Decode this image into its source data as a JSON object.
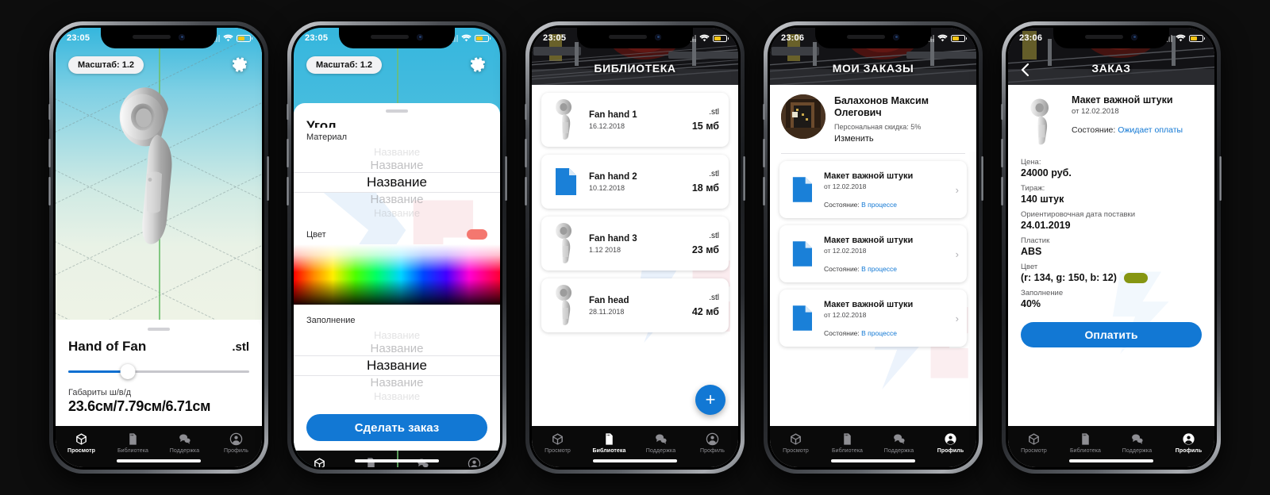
{
  "tabs": [
    {
      "label": "Просмотр",
      "icon": "cube-icon"
    },
    {
      "label": "Библиотека",
      "icon": "sdcard-icon"
    },
    {
      "label": "Поддержка",
      "icon": "chat-icon"
    },
    {
      "label": "Профиль",
      "icon": "person-icon"
    }
  ],
  "colors": {
    "accent": "#1278d4",
    "slider_fill": "#0b6fd1",
    "tab_active": "#ffffff",
    "tab_inactive": "#8e8e93",
    "material_swatch": "#f4776f",
    "order_color_chip": "#869612",
    "dark_header": "#17171a"
  },
  "phone1": {
    "status": {
      "time": "23:05",
      "battery": "60"
    },
    "scale_chip": "Масштаб: 1.2",
    "gear": "gear-icon",
    "sheet": {
      "title": "Hand of Fan",
      "extension": ".stl",
      "slider_value": "33",
      "dim_label": "Габариты ш/в/д",
      "dim_value": "23.6см/7.79см/6.71см"
    },
    "active_tab": 0
  },
  "phone2": {
    "status": {
      "time": "23:05",
      "battery": "60"
    },
    "scale_chip": "Масштаб: 1.2",
    "clipped_title": "Угол",
    "material": {
      "label": "Материал",
      "options": [
        "Название",
        "Название",
        "Название",
        "Название",
        "Название"
      ],
      "selected_index": 2
    },
    "color": {
      "label": "Цвет",
      "swatch": "#f4776f"
    },
    "infill": {
      "label": "Заполнение",
      "options": [
        "Название",
        "Название",
        "Название",
        "Название",
        "Название"
      ],
      "selected_index": 2
    },
    "order_button": "Сделать заказ",
    "active_tab": 0
  },
  "phone3": {
    "status": {
      "time": "23:05",
      "battery": "60"
    },
    "header_title": "БИБЛИОТЕКА",
    "files": [
      {
        "name": "Fan hand 1",
        "date": "16.12.2018",
        "ext": ".stl",
        "size": "15 мб",
        "thumb": "model-thumb"
      },
      {
        "name": "Fan hand 2",
        "date": "10.12.2018",
        "ext": ".stl",
        "size": "18 мб",
        "thumb": "file-icon"
      },
      {
        "name": "Fan hand 3",
        "date": "1.12 2018",
        "ext": ".stl",
        "size": "23 мб",
        "thumb": "model-thumb"
      },
      {
        "name": "Fan head",
        "date": "28.11.2018",
        "ext": ".stl",
        "size": "42 мб",
        "thumb": "model-thumb"
      }
    ],
    "fab_label": "+",
    "active_tab": 1
  },
  "phone4": {
    "status": {
      "time": "23:06",
      "battery": "60"
    },
    "header_title": "МОИ ЗАКАЗЫ",
    "profile": {
      "name": "Балахонов Максим Олегович",
      "discount": "Персональная скидка: 5%",
      "edit": "Изменить"
    },
    "orders": [
      {
        "title": "Макет важной штуки",
        "date": "от 12.02.2018",
        "state_label": "Состояние:",
        "state_value": "В процессе"
      },
      {
        "title": "Макет важной штуки",
        "date": "от 12.02.2018",
        "state_label": "Состояние:",
        "state_value": "В процессе"
      },
      {
        "title": "Макет важной штуки",
        "date": "от 12.02.2018",
        "state_label": "Состояние:",
        "state_value": "В процессе"
      }
    ],
    "active_tab": 3
  },
  "phone5": {
    "status": {
      "time": "23:06",
      "battery": "60"
    },
    "header_title": "ЗАКАЗ",
    "back": "back-chevron-icon",
    "order": {
      "title": "Макет важной штуки",
      "date": "от 12.02.2018",
      "state_label": "Состояние:",
      "state_value": "Ожидает оплаты"
    },
    "fields": [
      {
        "label": "Цена:",
        "value": "24000 руб."
      },
      {
        "label": "Тираж:",
        "value": "140 штук"
      },
      {
        "label": "Ориентировочная дата поставки",
        "value": "24.01.2019"
      },
      {
        "label": "Пластик",
        "value": "ABS"
      }
    ],
    "color_field": {
      "label": "Цвет",
      "value": "(r: 134, g: 150, b: 12)",
      "chip": "#869612"
    },
    "infill_field": {
      "label": "Заполнение",
      "value": "40%"
    },
    "pay_button": "Оплатить",
    "active_tab": 3
  }
}
